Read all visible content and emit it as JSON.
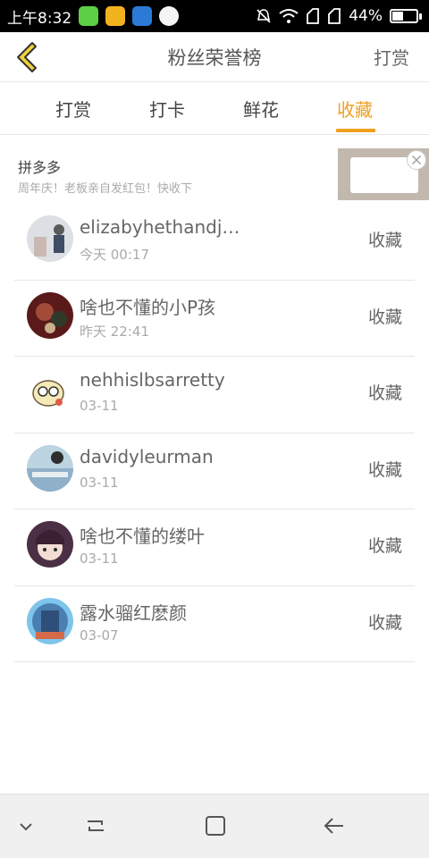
{
  "status_bar": {
    "time": "上午8:32",
    "battery_percent": "44%",
    "battery_level": 0.44,
    "app_icons": [
      "phone-app-icon",
      "folder-app-icon",
      "tc-app-icon",
      "smile-app-icon"
    ],
    "system_icons": [
      "bell-off-icon",
      "wifi-icon",
      "signal-icon",
      "signal-icon",
      "battery-icon"
    ]
  },
  "header": {
    "title": "粉丝荣誉榜",
    "action_label": "打赏"
  },
  "tabs": [
    {
      "label": "打赏",
      "active": false
    },
    {
      "label": "打卡",
      "active": false
    },
    {
      "label": "鲜花",
      "active": false
    },
    {
      "label": "收藏",
      "active": true
    }
  ],
  "ad": {
    "title": "拼多多",
    "subtitle": "周年庆！老板亲自发红包！快收下"
  },
  "fans": [
    {
      "name": "elizabyhethandjac...",
      "time": "今天 00:17",
      "action": "收藏"
    },
    {
      "name": "啥也不懂的小P孩",
      "time": "昨天 22:41",
      "action": "收藏"
    },
    {
      "name": "nehhislbsarretty",
      "time": "03-11",
      "action": "收藏"
    },
    {
      "name": "davidyleurman",
      "time": "03-11",
      "action": "收藏"
    },
    {
      "name": "啥也不懂的缕叶",
      "time": "03-11",
      "action": "收藏"
    },
    {
      "name": "露水骝红麽颜",
      "time": "03-07",
      "action": "收藏"
    }
  ],
  "colors": {
    "accent": "#f0a020",
    "back_icon_fill": "#f2d23a",
    "status_bar_bg": "#000000"
  }
}
